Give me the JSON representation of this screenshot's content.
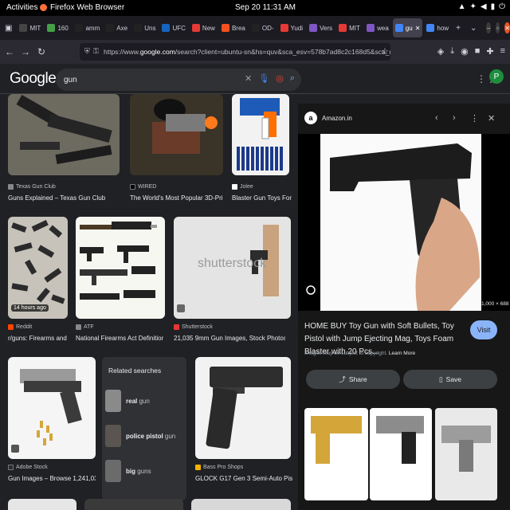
{
  "system_bar": {
    "activities": "Activities",
    "app_name": "Firefox Web Browser",
    "clock": "Sep 20  11:31 AM"
  },
  "tabs": [
    {
      "label": "MIT",
      "color": "#444"
    },
    {
      "label": "160",
      "color": "#43a047"
    },
    {
      "label": "amm",
      "color": "#222"
    },
    {
      "label": "Axe",
      "color": "#222"
    },
    {
      "label": "Uns",
      "color": "#222"
    },
    {
      "label": "UFC",
      "color": "#1565c0"
    },
    {
      "label": "New",
      "color": "#e53935"
    },
    {
      "label": "Brea",
      "color": "#f4511e"
    },
    {
      "label": "OD-",
      "color": "#222"
    },
    {
      "label": "Yudi",
      "color": "#e53935"
    },
    {
      "label": "Vers",
      "color": "#7e57c2"
    },
    {
      "label": "MIT",
      "color": "#e53935"
    },
    {
      "label": "wea",
      "color": "#7e57c2"
    },
    {
      "label": "gu",
      "color": "#4285f4",
      "active": true
    },
    {
      "label": "how",
      "color": "#4285f4"
    }
  ],
  "nav": {
    "url_prefix": "https://www.",
    "url_domain": "google.com",
    "url_rest": "/search?client=ubuntu-sn&hs=quv&sca_esv=578b7ad8c2c168d5&sca_upv=1&chan"
  },
  "google": {
    "logo": "Google",
    "query": "gun",
    "avatar": "P"
  },
  "results": [
    {
      "source": "Texas Gun Club",
      "caption": "Guns Explained – Texas Gun Club"
    },
    {
      "source": "WIRED",
      "caption": "The World's Most Popular 3D-Printed ..."
    },
    {
      "source": "Jolee",
      "caption": "Blaster Gun Toys For K..."
    },
    {
      "source": "Reddit",
      "caption": "r/guns: Firearms and re...",
      "badge": "14 hours ago"
    },
    {
      "source": "ATF",
      "caption": "National Firearms Act Definitions ..."
    },
    {
      "source": "Shutterstock",
      "caption": "21,035 9mm Gun Images, Stock Photos, 3D ...",
      "watermark": "shutterstock"
    },
    {
      "source": "Adobe Stock",
      "caption": "Gun Images – Browse 1,241,038 St..."
    },
    {
      "source": "Bass Pro Shops",
      "caption": "GLOCK G17 Gen 3 Semi-Auto Pistol | ..."
    }
  ],
  "related": {
    "title": "Related searches",
    "items": [
      {
        "bold": "real",
        "rest": " gun"
      },
      {
        "bold": "police pistol",
        "rest": " gun"
      },
      {
        "bold": "big",
        "rest": " guns"
      }
    ]
  },
  "panel": {
    "site": "Amazon.in",
    "logo_letter": "a",
    "image_size": "1,000 × 688",
    "title": "HOME BUY Toy Gun with Soft Bullets, Toy Pistol with Jump Ejecting Mag, Toys Foam Blaster with 20 Pcs...",
    "visit": "Visit",
    "copyright": "Images may be subject to copyright.",
    "learn_more": "Learn More",
    "share": "Share",
    "save": "Save"
  },
  "colors": {
    "accent": "#8ab4f8",
    "background": "#202124",
    "close": "#e95420"
  }
}
